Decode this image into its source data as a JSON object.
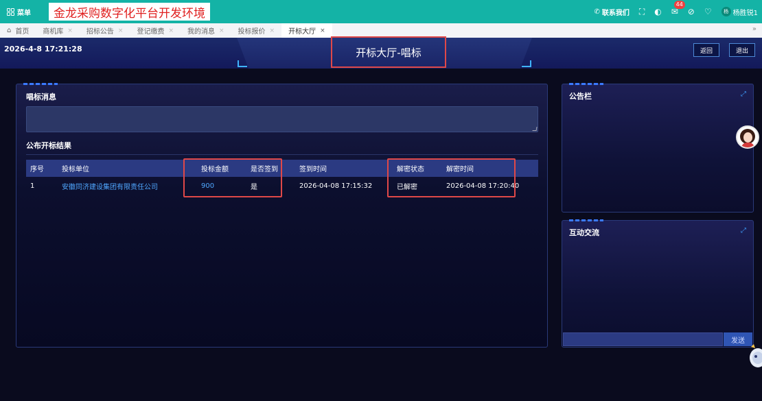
{
  "topbar": {
    "menu_label": "菜单",
    "app_title": "金龙采购数字化平台开发环境",
    "contact_label": "联系我们",
    "notification_count": "44",
    "user_name": "杨胜锐1",
    "user_avatar_text": "杨"
  },
  "tabs": {
    "home": "首页",
    "items": [
      {
        "label": "商机库"
      },
      {
        "label": "招标公告"
      },
      {
        "label": "登记缴费"
      },
      {
        "label": "我的消息"
      },
      {
        "label": "投标报价"
      },
      {
        "label": "开标大厅"
      }
    ],
    "active_index": 5
  },
  "header": {
    "datetime": "2026-4-8 17:21:28",
    "hall_title": "开标大厅-唱标",
    "back_label": "返回",
    "exit_label": "退出"
  },
  "main": {
    "chang_title": "唱标消息",
    "chang_message": "",
    "result_title": "公布开标结果",
    "table": {
      "headers": {
        "seq": "序号",
        "unit": "投标单位",
        "amount": "投标金额",
        "signed": "是否签到",
        "sign_time": "签到时间",
        "decrypt_state": "解密状态",
        "decrypt_time": "解密时间"
      },
      "rows": [
        {
          "seq": "1",
          "unit": "安徽同济建设集团有限责任公司",
          "amount": "900",
          "signed": "是",
          "sign_time": "2026-04-08 17:15:32",
          "decrypt_state": "已解密",
          "decrypt_time": "2026-04-08 17:20:40"
        }
      ]
    }
  },
  "notice_panel": {
    "title": "公告栏"
  },
  "chat_panel": {
    "title": "互动交流",
    "input_value": "",
    "send_label": "发送"
  },
  "colors": {
    "topbar": "#14b3a6",
    "title_red": "#e02020",
    "highlight_red": "#e04848",
    "link_blue": "#4fa7ff",
    "background": "#0a0b1e"
  },
  "icons": [
    "grid-menu-icon",
    "phone-icon",
    "fullscreen-icon",
    "theme-icon",
    "mail-icon",
    "check-circle-icon",
    "bulb-icon",
    "expand-icon",
    "home-icon",
    "tabs-more-icon"
  ]
}
